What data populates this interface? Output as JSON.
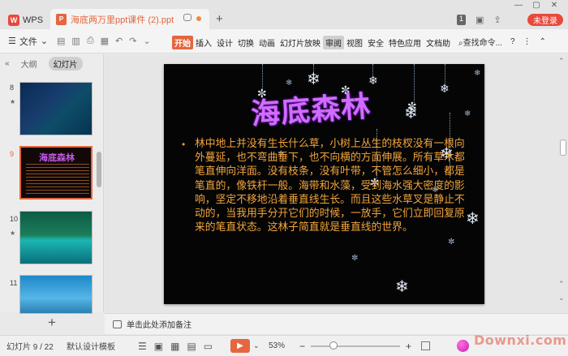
{
  "titlebar": {
    "app_tab": "WPS",
    "doc_tab": "海底两万里ppt课件 (2).ppt",
    "new_tab": "+",
    "badge": "1",
    "login": "未登录",
    "window_controls": [
      "—",
      "▢",
      "✕"
    ]
  },
  "ribbon": {
    "file_menu": "文件",
    "tabs": [
      "开始",
      "插入",
      "设计",
      "切换",
      "动画",
      "幻灯片放映",
      "审阅",
      "视图",
      "安全",
      "特色应用",
      "文档助"
    ],
    "active_tab": "开始",
    "selected_tab": "审阅",
    "search": "查找命令...",
    "help": "?"
  },
  "leftpanel": {
    "tabs": [
      "大纲",
      "幻灯片"
    ],
    "active_tab": "幻灯片",
    "slides": [
      {
        "num": "8"
      },
      {
        "num": "9"
      },
      {
        "num": "10"
      },
      {
        "num": "11"
      }
    ],
    "selected_slide": "9",
    "add_label": "+"
  },
  "slide": {
    "title": "海底森林",
    "body": "林中地上并没有生长什么草，小树上丛生的枝杈没有一根向外蔓延，也不弯曲垂下，也不向横的方面伸展。所有草木都笔直伸向洋面。没有枝条，没有叶带，不管怎么细小，都是笔直的，像铁杆一般。海带和水藻，受到海水强大密度的影响，坚定不移地沿着垂直线生长。而且这些水草叉是静止不动的，当我用手分开它们的时候，一放手，它们立即回复原来的笔直状态。这林子简直就是垂直线的世界。"
  },
  "notes": {
    "placeholder": "单击此处添加备注"
  },
  "statusbar": {
    "slide_counter": "幻灯片 9 / 22",
    "template": "默认设计模板",
    "zoom": "53%",
    "zoom_fraction": 0.25,
    "watermark": "Downxi.com"
  },
  "colors": {
    "accent": "#e5663f",
    "login_red": "#e8493c",
    "title_purple": "#d26bff",
    "body_orange": "#f2a53c"
  }
}
